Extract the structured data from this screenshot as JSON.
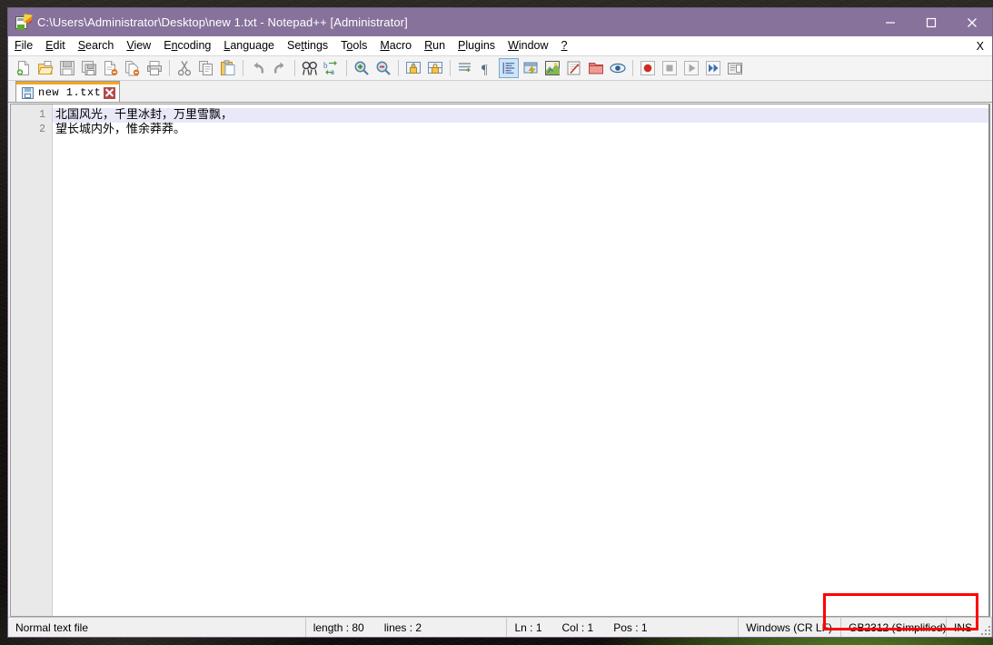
{
  "window": {
    "title": "C:\\Users\\Administrator\\Desktop\\new 1.txt - Notepad++ [Administrator]",
    "app_icon": "notepad-plus-plus-icon",
    "titlebar_color": "#87729b",
    "controls": {
      "minimize": "minimize-button",
      "maximize": "maximize-button",
      "close": "close-button"
    }
  },
  "menubar": {
    "items": [
      {
        "label": "File",
        "accel": "F"
      },
      {
        "label": "Edit",
        "accel": "E"
      },
      {
        "label": "Search",
        "accel": "S"
      },
      {
        "label": "View",
        "accel": "V"
      },
      {
        "label": "Encoding",
        "accel": "n"
      },
      {
        "label": "Language",
        "accel": "L"
      },
      {
        "label": "Settings",
        "accel": "t"
      },
      {
        "label": "Tools",
        "accel": "o"
      },
      {
        "label": "Macro",
        "accel": "M"
      },
      {
        "label": "Run",
        "accel": "R"
      },
      {
        "label": "Plugins",
        "accel": "P"
      },
      {
        "label": "Window",
        "accel": "W"
      },
      {
        "label": "?",
        "accel": "?"
      }
    ],
    "close_document_label": "X"
  },
  "toolbar": {
    "buttons": [
      {
        "name": "new-file-icon",
        "tooltip": "New"
      },
      {
        "name": "open-file-icon",
        "tooltip": "Open"
      },
      {
        "name": "save-icon",
        "tooltip": "Save"
      },
      {
        "name": "save-all-icon",
        "tooltip": "Save All"
      },
      {
        "name": "close-file-icon",
        "tooltip": "Close"
      },
      {
        "name": "close-all-files-icon",
        "tooltip": "Close All"
      },
      {
        "name": "print-icon",
        "tooltip": "Print"
      },
      {
        "name": "separator",
        "tooltip": ""
      },
      {
        "name": "cut-icon",
        "tooltip": "Cut"
      },
      {
        "name": "copy-icon",
        "tooltip": "Copy"
      },
      {
        "name": "paste-icon",
        "tooltip": "Paste"
      },
      {
        "name": "separator",
        "tooltip": ""
      },
      {
        "name": "undo-icon",
        "tooltip": "Undo"
      },
      {
        "name": "redo-icon",
        "tooltip": "Redo"
      },
      {
        "name": "separator",
        "tooltip": ""
      },
      {
        "name": "find-icon",
        "tooltip": "Find"
      },
      {
        "name": "replace-icon",
        "tooltip": "Replace"
      },
      {
        "name": "separator",
        "tooltip": ""
      },
      {
        "name": "zoom-in-icon",
        "tooltip": "Zoom In"
      },
      {
        "name": "zoom-out-icon",
        "tooltip": "Zoom Out"
      },
      {
        "name": "separator",
        "tooltip": ""
      },
      {
        "name": "sync-vertical-scroll-icon",
        "tooltip": "Synchronize Vertical Scrolling"
      },
      {
        "name": "sync-horizontal-scroll-icon",
        "tooltip": "Synchronize Horizontal Scrolling"
      },
      {
        "name": "separator",
        "tooltip": ""
      },
      {
        "name": "word-wrap-icon",
        "tooltip": "Word wrap"
      },
      {
        "name": "show-all-characters-icon",
        "tooltip": "Show All Characters"
      },
      {
        "name": "show-indent-guide-icon",
        "tooltip": "Show Indent Guide"
      },
      {
        "name": "user-defined-dialogue-icon",
        "tooltip": "UserDefine Dialogue"
      },
      {
        "name": "document-map-icon",
        "tooltip": "Document Map"
      },
      {
        "name": "function-list-icon",
        "tooltip": "Function List"
      },
      {
        "name": "folder-as-workspace-icon",
        "tooltip": "Folder as Workspace"
      },
      {
        "name": "monitoring-icon",
        "tooltip": "Monitoring"
      },
      {
        "name": "separator",
        "tooltip": ""
      },
      {
        "name": "record-macro-icon",
        "tooltip": "Start Recording"
      },
      {
        "name": "stop-macro-icon",
        "tooltip": "Stop Recording"
      },
      {
        "name": "play-macro-icon",
        "tooltip": "Playback"
      },
      {
        "name": "run-macro-multiple-icon",
        "tooltip": "Run a Macro Multiple Times"
      },
      {
        "name": "save-macro-icon",
        "tooltip": "Save Current Recorded Macro"
      }
    ]
  },
  "tabs": [
    {
      "label": "new 1.txt",
      "icon": "save-icon",
      "close": "close-tab-icon",
      "active": true
    }
  ],
  "editor": {
    "lines": [
      {
        "number": "1",
        "text": "北国风光，千里冰封，万里雪飘，",
        "current": true
      },
      {
        "number": "2",
        "text": "望长城内外，惟余莽莽。",
        "current": false
      }
    ]
  },
  "statusbar": {
    "filetype": "Normal text file",
    "length_label": "length : 80",
    "lines_label": "lines : 2",
    "ln": "Ln : 1",
    "col": "Col : 1",
    "pos": "Pos : 1",
    "eol": "Windows (CR LF)",
    "encoding": "GB2312 (Simplified)",
    "insert_mode": "INS"
  },
  "annotation": {
    "color": "#ff0000",
    "target": "encoding-and-insert-mode"
  }
}
